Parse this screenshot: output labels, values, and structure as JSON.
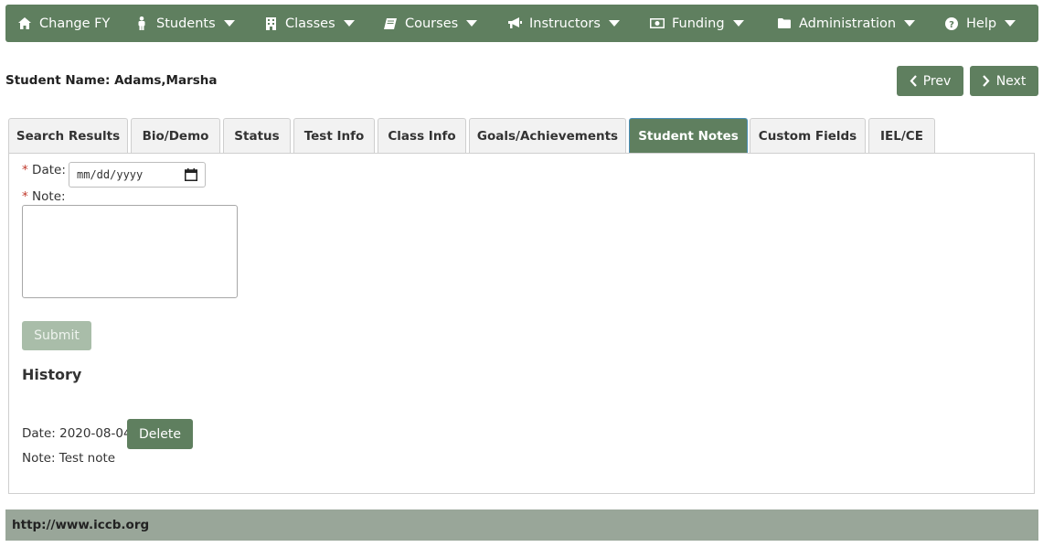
{
  "colors": {
    "brand": "#5f7f5f",
    "footer": "#99a699",
    "required": "#c0392b",
    "submit_disabled": "#a9bda9"
  },
  "nav": {
    "items": [
      {
        "label": "Change FY",
        "icon": "home-icon",
        "has_caret": false
      },
      {
        "label": "Students",
        "icon": "person-icon",
        "has_caret": true
      },
      {
        "label": "Classes",
        "icon": "building-icon",
        "has_caret": true
      },
      {
        "label": "Courses",
        "icon": "book-icon",
        "has_caret": true
      },
      {
        "label": "Instructors",
        "icon": "bullhorn-icon",
        "has_caret": true
      },
      {
        "label": "Funding",
        "icon": "money-icon",
        "has_caret": true
      },
      {
        "label": "Administration",
        "icon": "folder-icon",
        "has_caret": true
      },
      {
        "label": "Help",
        "icon": "question-icon",
        "has_caret": true
      }
    ]
  },
  "student": {
    "label": "Student Name:",
    "name": "Adams,Marsha"
  },
  "pager": {
    "prev": "Prev",
    "next": "Next"
  },
  "tabs": [
    {
      "label": "Search Results",
      "active": false
    },
    {
      "label": "Bio/Demo",
      "active": false
    },
    {
      "label": "Status",
      "active": false
    },
    {
      "label": "Test Info",
      "active": false
    },
    {
      "label": "Class Info",
      "active": false
    },
    {
      "label": "Goals/Achievements",
      "active": false
    },
    {
      "label": "Student Notes",
      "active": true
    },
    {
      "label": "Custom Fields",
      "active": false
    },
    {
      "label": "IEL/CE",
      "active": false
    }
  ],
  "form": {
    "required_mark": "*",
    "date_label": "Date:",
    "date_placeholder": "mm/dd/yyyy",
    "note_label": "Note:",
    "note_value": "",
    "submit": "Submit"
  },
  "history": {
    "title": "History",
    "entries": [
      {
        "date_text": "Date: 2020-08-04",
        "note_text": "Note: Test note",
        "delete_label": "Delete"
      }
    ]
  },
  "footer": {
    "text": "http://www.iccb.org"
  }
}
